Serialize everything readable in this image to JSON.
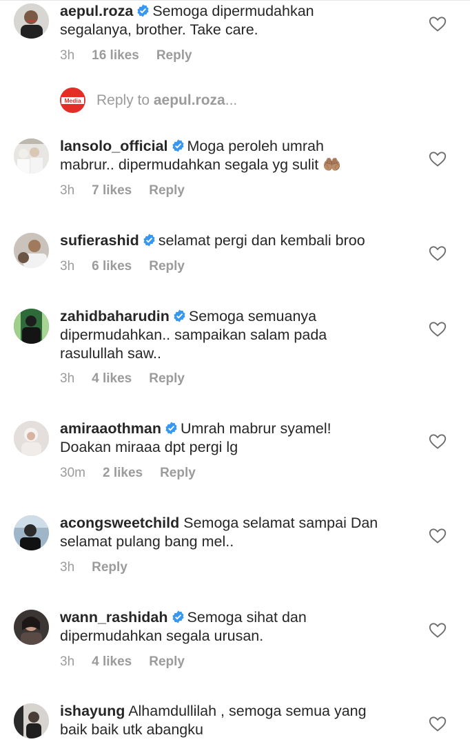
{
  "colors": {
    "verified": "#3897f0",
    "muted": "#9b9b9b",
    "text": "#262626"
  },
  "reply_to": {
    "prefix": "Reply to ",
    "target": "aepul.roza",
    "suffix": "...",
    "logo_text": "Media"
  },
  "comments": [
    {
      "username": "aepul.roza",
      "verified": true,
      "line1": "Semoga dipermudahkan",
      "line2": "segalanya, brother. Take care.",
      "line3": "",
      "time": "3h",
      "likes": "16 likes",
      "reply": "Reply"
    },
    {
      "username": "lansolo_official",
      "verified": true,
      "line1": "Moga peroleh umrah",
      "line2": "mabrur.. dipermudahkan segala yg sulit 🤲🏽",
      "line3": "",
      "time": "3h",
      "likes": "7 likes",
      "reply": "Reply"
    },
    {
      "username": "sufierashid",
      "verified": true,
      "line1": "selamat pergi dan kembali broo",
      "line2": "",
      "line3": "",
      "time": "3h",
      "likes": "6 likes",
      "reply": "Reply"
    },
    {
      "username": "zahidbaharudin",
      "verified": true,
      "line1": "Semoga semuanya",
      "line2": "dipermudahkan.. sampaikan salam pada",
      "line3": "rasulullah saw..",
      "time": "3h",
      "likes": "4 likes",
      "reply": "Reply"
    },
    {
      "username": "amiraaothman",
      "verified": true,
      "line1": "Umrah mabrur syamel!",
      "line2": "Doakan miraaa dpt pergi lg",
      "line3": "",
      "time": "30m",
      "likes": "2 likes",
      "reply": "Reply"
    },
    {
      "username": "acongsweetchild",
      "verified": false,
      "line1": "Semoga selamat sampai Dan",
      "line2": "selamat pulang bang mel..",
      "line3": "",
      "time": "3h",
      "likes": "",
      "reply": "Reply"
    },
    {
      "username": "wann_rashidah",
      "verified": true,
      "line1": "Semoga sihat dan",
      "line2": "dipermudahkan segala urusan.",
      "line3": "",
      "time": "3h",
      "likes": "4 likes",
      "reply": "Reply"
    },
    {
      "username": "ishayung",
      "verified": false,
      "line1": "Alhamdullilah , semoga semua yang",
      "line2": "baik baik utk abangku",
      "line3": "",
      "time": "",
      "likes": "",
      "reply": ""
    }
  ]
}
